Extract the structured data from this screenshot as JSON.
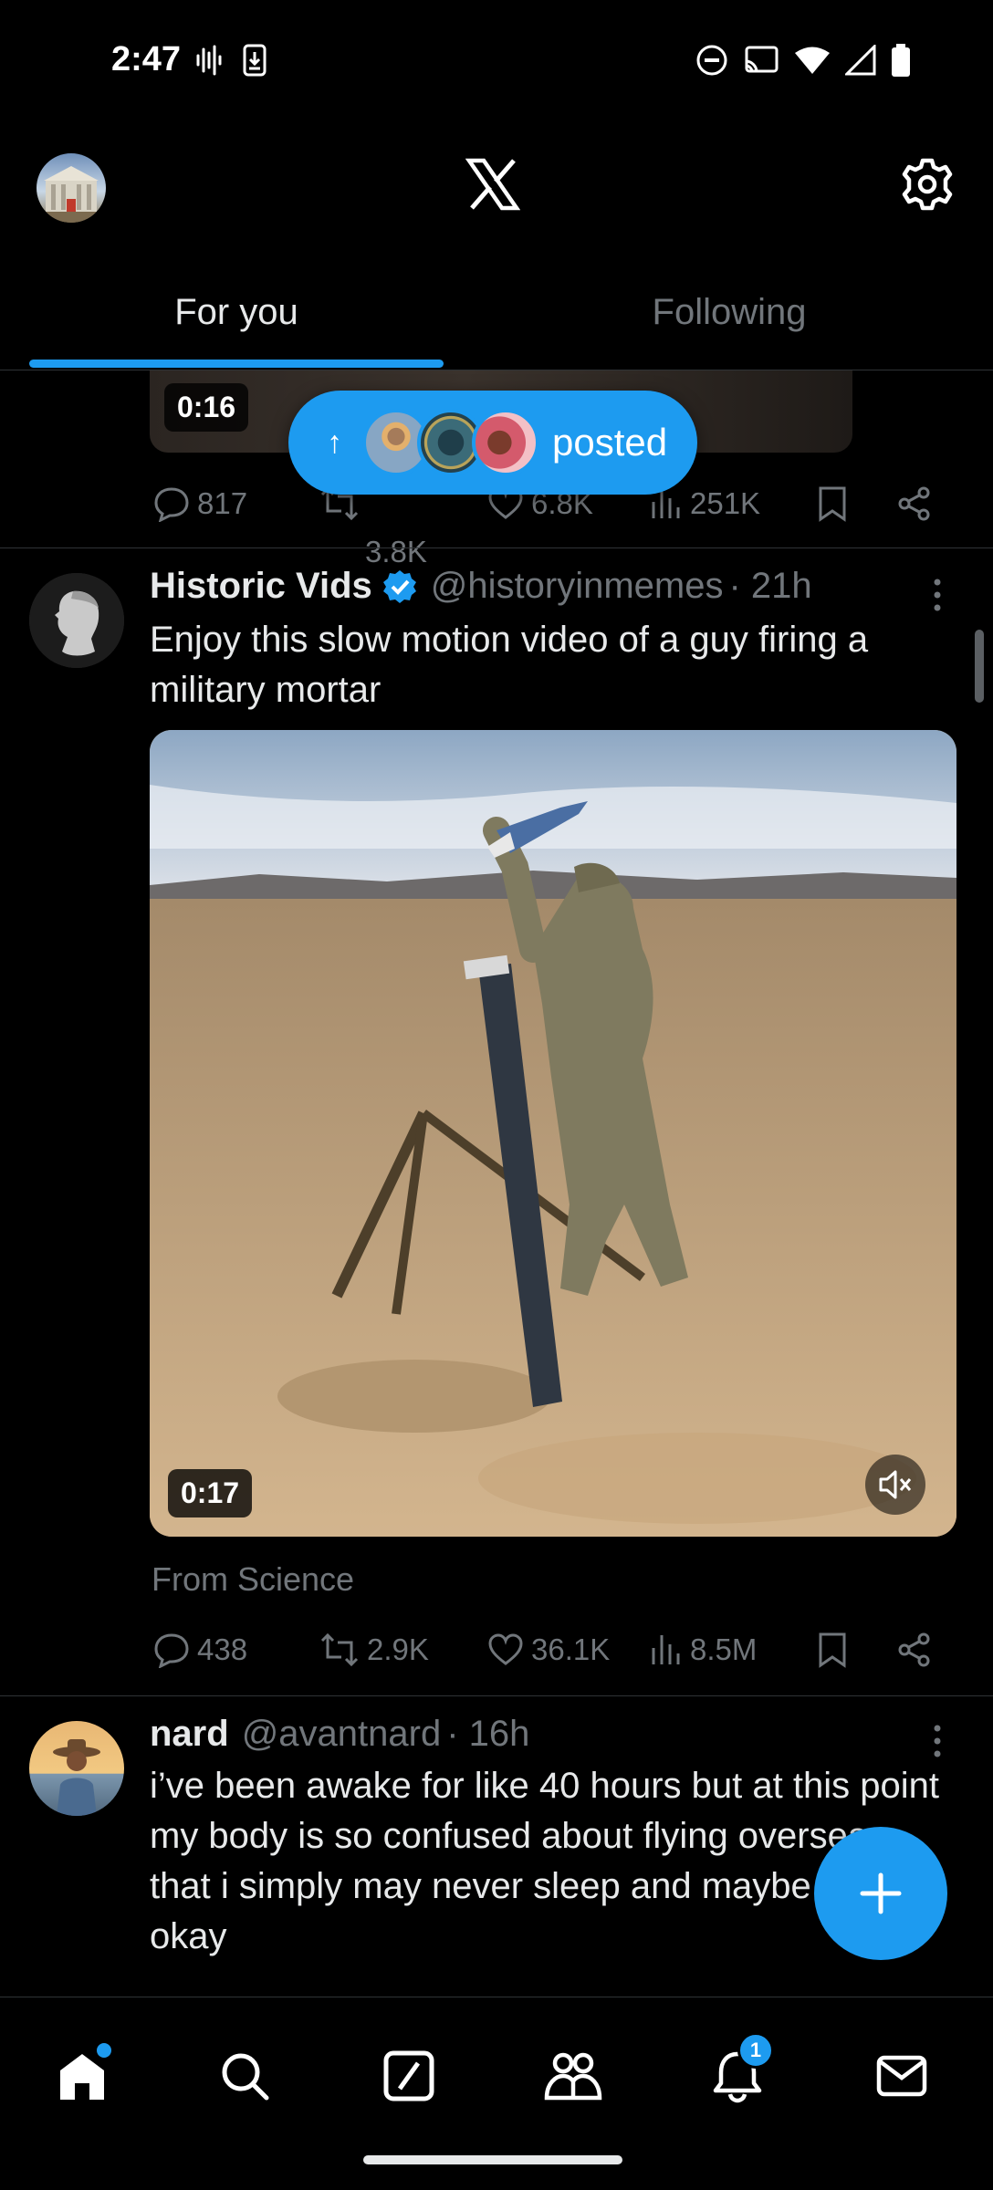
{
  "status_bar": {
    "time": "2:47"
  },
  "header": {
    "logo": "x-logo",
    "settings_icon": "gear-icon"
  },
  "tabs": [
    {
      "label": "For you",
      "active": true
    },
    {
      "label": "Following",
      "active": false
    }
  ],
  "previous_tweet": {
    "video_duration": "0:16",
    "replies": "817",
    "reposts": "3.8K",
    "likes": "6.8K",
    "views": "251K"
  },
  "new_posts_pill": {
    "label": "posted"
  },
  "tweets": [
    {
      "display_name": "Historic Vids",
      "verified": true,
      "handle": "@historyinmemes",
      "time": "· 21h",
      "text": "Enjoy this slow motion video of a guy firing a military mortar",
      "video_duration": "0:17",
      "source_label": "From Science",
      "replies": "438",
      "reposts": "2.9K",
      "likes": "36.1K",
      "views": "8.5M"
    },
    {
      "display_name": "nard",
      "handle": "@avantnard",
      "time": "· 16h",
      "text": "i’ve been awake for like 40 hours but at this point my body is so confused about flying overseas that i simply may never sleep and maybe that’s okay"
    }
  ],
  "bottom_nav": {
    "items": [
      "home",
      "search",
      "grok",
      "communities",
      "notifications",
      "messages"
    ],
    "notifications_badge": "1"
  },
  "colors": {
    "accent": "#1d9bf0",
    "background": "#000000",
    "muted_text": "#71767b"
  }
}
